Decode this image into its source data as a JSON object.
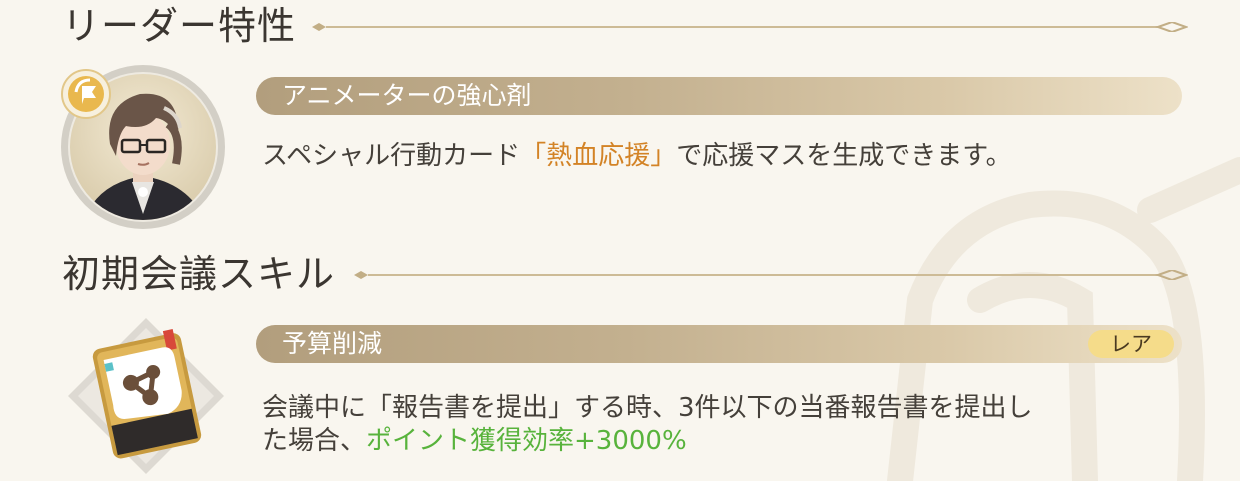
{
  "leader_trait": {
    "section_title": "リーダー特性",
    "name": "アニメーターの強心剤",
    "description": {
      "before": "スペシャル行動カード",
      "highlight": "「熱血応援」",
      "after": "で応援マスを生成できます。"
    },
    "highlight_color": "#d38326"
  },
  "meeting_skill": {
    "section_title": "初期会議スキル",
    "name": "予算削減",
    "rarity": "レア",
    "description": {
      "line1": "会議中に「報告書を提出」する時、3件以下の当番報告書を提出し",
      "line2_before": "た場合、",
      "highlight": "ポイント獲得効率+3000%"
    },
    "highlight_color": "#58b33c"
  },
  "icons": {
    "character_badge": "flag-badge-icon",
    "skill_card": "skill-card-icon",
    "header_ornament": "diamond-line-ornament"
  }
}
